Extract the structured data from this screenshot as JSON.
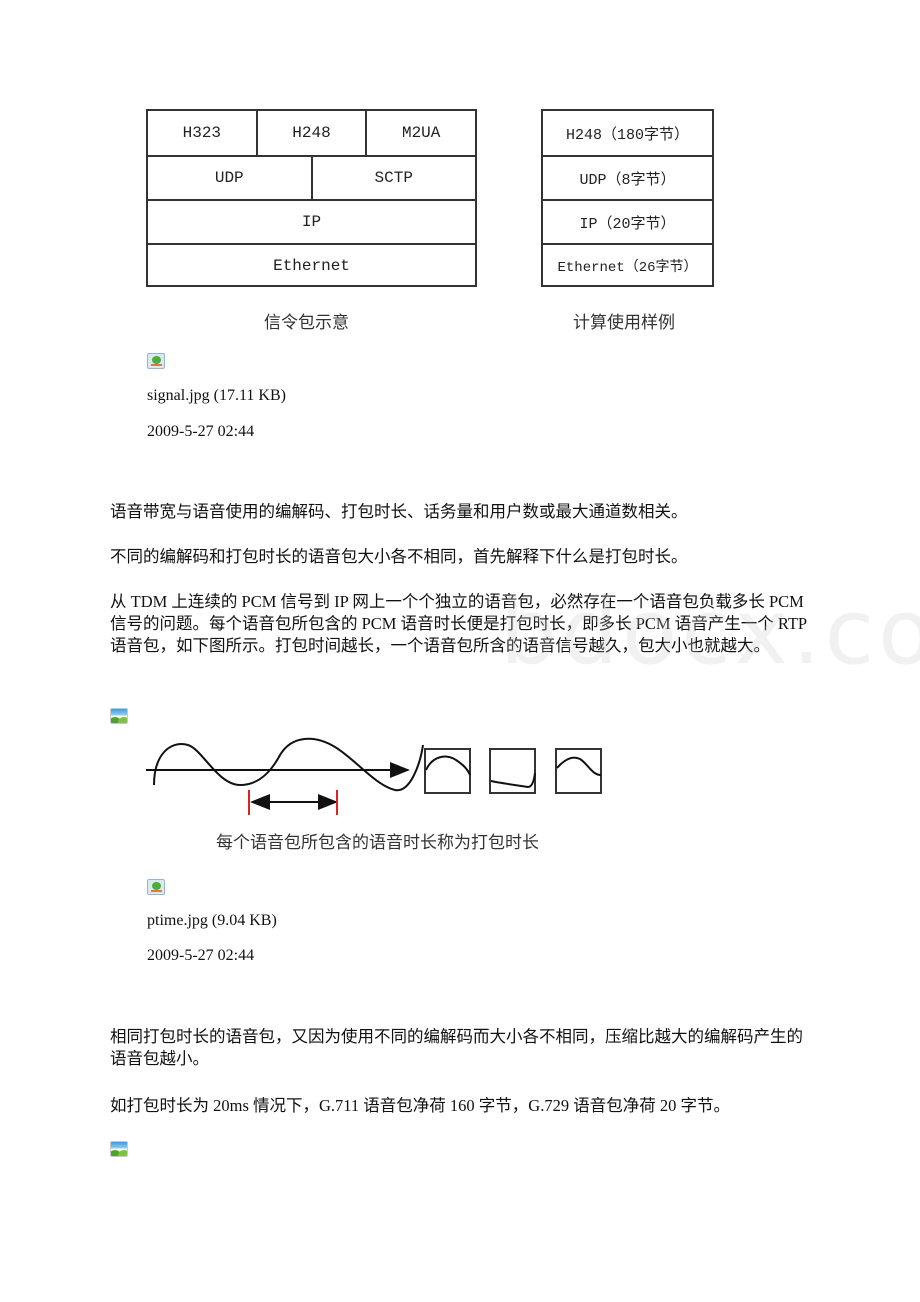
{
  "figure1": {
    "signal_stack": {
      "rows": [
        [
          "H323",
          "H248",
          "M2UA"
        ],
        [
          "UDP",
          "SCTP"
        ],
        [
          "IP"
        ],
        [
          "Ethernet"
        ]
      ],
      "caption": "信令包示意"
    },
    "calc_stack": {
      "rows": [
        [
          "H248（180字节）"
        ],
        [
          "UDP（8字节）"
        ],
        [
          "IP（20字节）"
        ],
        [
          "Ethernet（26字节）"
        ]
      ],
      "caption": "计算使用样例"
    }
  },
  "attachment1": {
    "icon": "broken-image-icon",
    "filename": "signal.jpg (17.11 KB)",
    "date": "2009-5-27 02:44"
  },
  "paragraphs": {
    "p1": "语音带宽与语音使用的编解码、打包时长、话务量和用户数或最大通道数相关。",
    "p2": "不同的编解码和打包时长的语音包大小各不相同，首先解释下什么是打包时长。",
    "p3": "从 TDM 上连续的 PCM 信号到 IP 网上一个个独立的语音包，必然存在一个语音包负载多长 PCM 信号的问题。每个语音包所包含的 PCM 语音时长便是打包时长，即多长 PCM 语音产生一个 RTP 语音包，如下图所示。打包时间越长，一个语音包所含的语音信号越久，包大小也就越大。",
    "p4": "相同打包时长的语音包，又因为使用不同的编解码而大小各不相同，压缩比越大的编解码产生的语音包越小。",
    "p5": "如打包时长为 20ms 情况下，G.711 语音包净荷 160 字节，G.729 语音包净荷 20 字节。"
  },
  "figure2": {
    "icon": "image-icon",
    "caption": "每个语音包所包含的语音时长称为打包时长"
  },
  "attachment2": {
    "icon": "broken-image-icon",
    "filename": "ptime.jpg (9.04 KB)",
    "date": "2009-5-27 02:44"
  },
  "figure3": {
    "icon": "image-icon"
  },
  "watermark": "bdocx.com"
}
